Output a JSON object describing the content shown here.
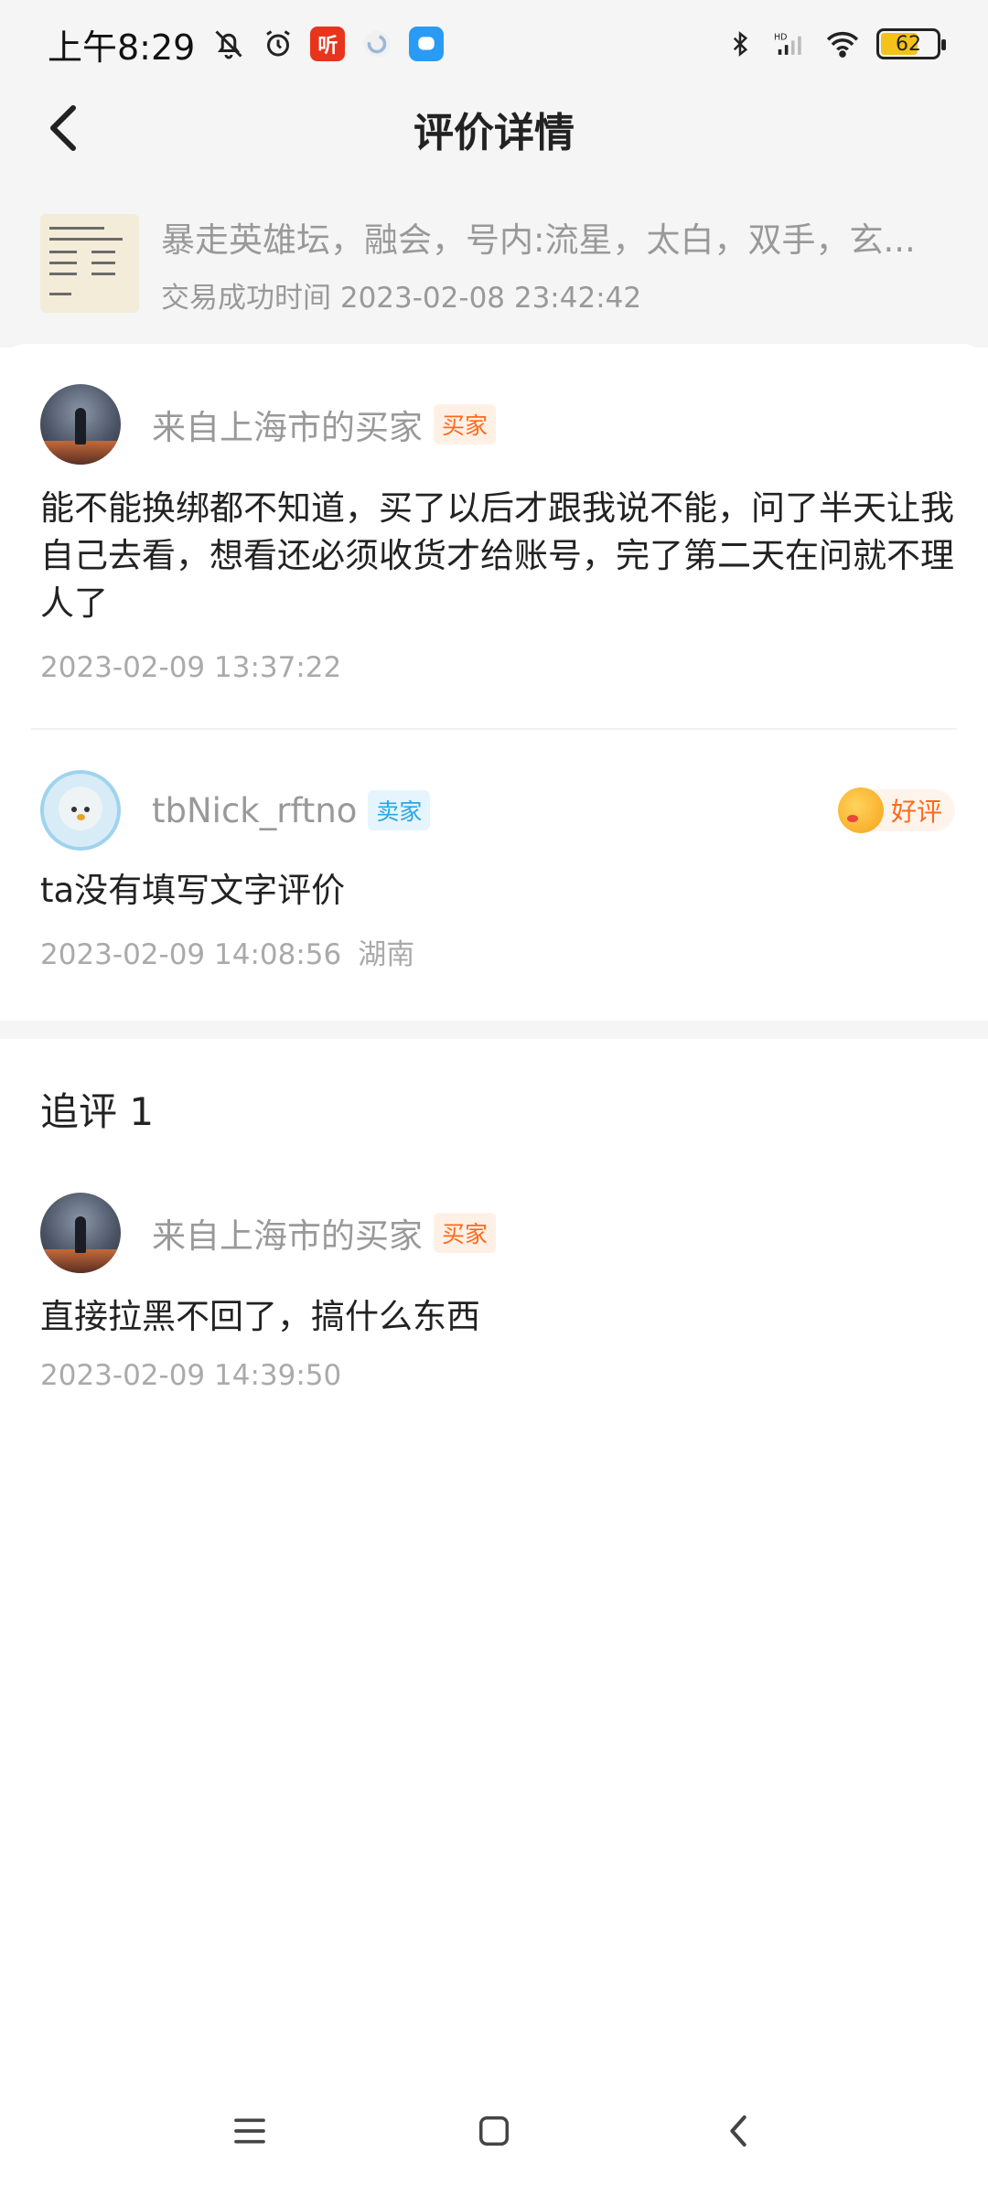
{
  "status_bar": {
    "time": "上午8:29",
    "left_icons": [
      "mute-bell-icon",
      "alarm-icon",
      "ting-app-icon",
      "loading-app-icon",
      "message-app-icon"
    ],
    "ting_label": "听",
    "right_icons": [
      "bluetooth-icon",
      "hd-signal-icon",
      "wifi-icon",
      "battery-icon"
    ],
    "battery": "62"
  },
  "header": {
    "title": "评价详情"
  },
  "product": {
    "title": "暴走英雄坛，融会，号内:流星，太白，双手，玄...",
    "deal_time": "交易成功时间 2023-02-08 23:42:42"
  },
  "reviews": [
    {
      "user": "来自上海市的买家",
      "role": "买家",
      "text": "能不能换绑都不知道，买了以后才跟我说不能，问了半天让我自己去看，想看还必须收货才给账号，完了第二天在问就不理人了",
      "time": "2023-02-09 13:37:22"
    },
    {
      "user": "tbNick_rftno",
      "role": "卖家",
      "rating": "好评",
      "text": "ta没有填写文字评价",
      "time": "2023-02-09 14:08:56",
      "location": "湖南"
    }
  ],
  "followup": {
    "title": "追评 1",
    "user": "来自上海市的买家",
    "role": "买家",
    "text": "直接拉黑不回了，搞什么东西",
    "time": "2023-02-09 14:39:50"
  },
  "nav_bar": {
    "icons": [
      "menu-icon",
      "home-icon",
      "back-icon"
    ]
  }
}
